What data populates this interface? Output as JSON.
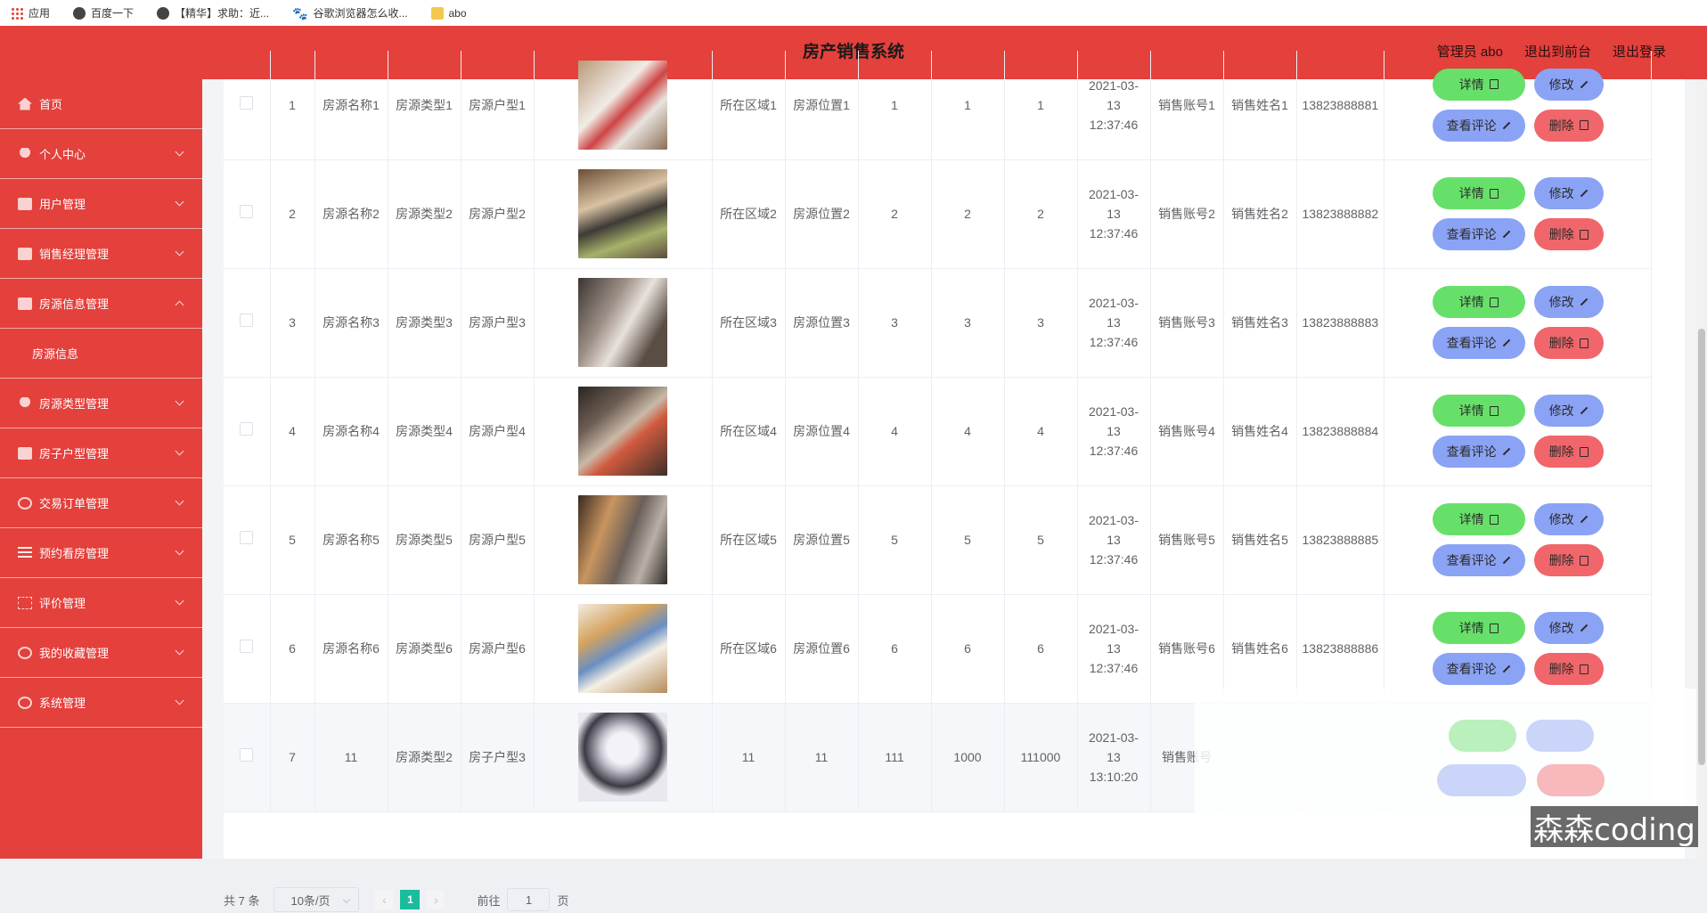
{
  "bookmarks": [
    {
      "icon": "apps-icon",
      "label": "应用"
    },
    {
      "icon": "globe-icon",
      "label": "百度一下"
    },
    {
      "icon": "globe-icon",
      "label": "【精华】求助：近..."
    },
    {
      "icon": "paw-icon",
      "label": "谷歌浏览器怎么收..."
    },
    {
      "icon": "folder-icon",
      "label": "abo"
    }
  ],
  "header": {
    "title": "房产销售系统",
    "admin": "管理员 abo",
    "to_front": "退出到前台",
    "logout": "退出登录"
  },
  "sidebar": {
    "items": [
      {
        "label": "首页",
        "icon": "home-icon"
      },
      {
        "label": "个人中心",
        "icon": "user-icon"
      },
      {
        "label": "用户管理",
        "icon": "monitor-icon"
      },
      {
        "label": "销售经理管理",
        "icon": "clipboard-icon"
      },
      {
        "label": "房源信息管理",
        "icon": "briefcase-icon"
      },
      {
        "label": "房源信息",
        "icon": ""
      },
      {
        "label": "房源类型管理",
        "icon": "user-icon"
      },
      {
        "label": "房子户型管理",
        "icon": "monitor-icon"
      },
      {
        "label": "交易订单管理",
        "icon": "ring-icon"
      },
      {
        "label": "预约看房管理",
        "icon": "list-icon"
      },
      {
        "label": "评价管理",
        "icon": "frame-icon"
      },
      {
        "label": "我的收藏管理",
        "icon": "power-icon"
      },
      {
        "label": "系统管理",
        "icon": "settings-icon"
      }
    ]
  },
  "table": {
    "rows": [
      {
        "idx": "1",
        "name": "房源名称1",
        "type": "房源类型1",
        "layout": "房源户型1",
        "area": "所在区域1",
        "loc": "房源位置1",
        "c1": "1",
        "c2": "1",
        "c3": "1",
        "time": "2021-03-13 12:37:46",
        "account": "销售账号1",
        "seller": "销售姓名1",
        "phone": "13823888881"
      },
      {
        "idx": "2",
        "name": "房源名称2",
        "type": "房源类型2",
        "layout": "房源户型2",
        "area": "所在区域2",
        "loc": "房源位置2",
        "c1": "2",
        "c2": "2",
        "c3": "2",
        "time": "2021-03-13 12:37:46",
        "account": "销售账号2",
        "seller": "销售姓名2",
        "phone": "13823888882"
      },
      {
        "idx": "3",
        "name": "房源名称3",
        "type": "房源类型3",
        "layout": "房源户型3",
        "area": "所在区域3",
        "loc": "房源位置3",
        "c1": "3",
        "c2": "3",
        "c3": "3",
        "time": "2021-03-13 12:37:46",
        "account": "销售账号3",
        "seller": "销售姓名3",
        "phone": "13823888883"
      },
      {
        "idx": "4",
        "name": "房源名称4",
        "type": "房源类型4",
        "layout": "房源户型4",
        "area": "所在区域4",
        "loc": "房源位置4",
        "c1": "4",
        "c2": "4",
        "c3": "4",
        "time": "2021-03-13 12:37:46",
        "account": "销售账号4",
        "seller": "销售姓名4",
        "phone": "13823888884"
      },
      {
        "idx": "5",
        "name": "房源名称5",
        "type": "房源类型5",
        "layout": "房源户型5",
        "area": "所在区域5",
        "loc": "房源位置5",
        "c1": "5",
        "c2": "5",
        "c3": "5",
        "time": "2021-03-13 12:37:46",
        "account": "销售账号5",
        "seller": "销售姓名5",
        "phone": "13823888885"
      },
      {
        "idx": "6",
        "name": "房源名称6",
        "type": "房源类型6",
        "layout": "房源户型6",
        "area": "所在区域6",
        "loc": "房源位置6",
        "c1": "6",
        "c2": "6",
        "c3": "6",
        "time": "2021-03-13 12:37:46",
        "account": "销售账号6",
        "seller": "销售姓名6",
        "phone": "13823888886"
      },
      {
        "idx": "7",
        "name": "11",
        "type": "房源类型2",
        "layout": "房子户型3",
        "area": "11",
        "loc": "11",
        "c1": "111",
        "c2": "1000",
        "c3": "111000",
        "time": "2021-03-13 13:10:20",
        "account": "销售账号",
        "seller": "",
        "phone": ""
      }
    ],
    "actions": {
      "detail": "详情",
      "edit": "修改",
      "comments": "查看评论",
      "delete": "删除"
    }
  },
  "pager": {
    "total": "共 7 条",
    "page_size": "10条/页",
    "prev": "‹",
    "current": "1",
    "next": "›",
    "goto_prefix": "前往",
    "goto_value": "1",
    "goto_suffix": "页"
  },
  "watermark": "森森coding",
  "colors": {
    "primary": "#e4403c",
    "detail": "#67e06a",
    "edit": "#8ba3f5",
    "delete": "#f0666a",
    "page": "#1abc9c"
  }
}
